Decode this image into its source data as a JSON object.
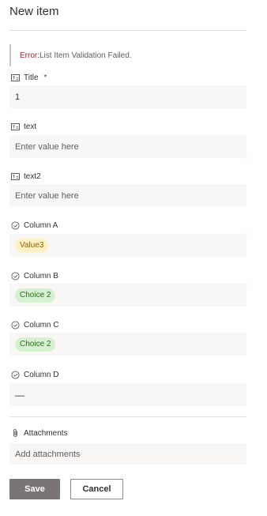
{
  "panel": {
    "title": "New item",
    "error_prefix": "Error:",
    "error_message": " List Item Validation Failed."
  },
  "fields": {
    "title": {
      "label": "Title",
      "required_mark": "*",
      "value": "1",
      "icon": "text-field-icon"
    },
    "text": {
      "label": "text",
      "placeholder": "Enter value here",
      "icon": "text-field-icon"
    },
    "text2": {
      "label": "text2",
      "placeholder": "Enter value here",
      "icon": "text-field-icon"
    },
    "column_a": {
      "label": "Column A",
      "value": "Value3",
      "icon": "choice-check-icon",
      "pill_color": "#fff1c6"
    },
    "column_b": {
      "label": "Column B",
      "value": "Choice 2",
      "icon": "choice-check-icon",
      "pill_color": "#d6f1d0"
    },
    "column_c": {
      "label": "Column C",
      "value": "Choice 2",
      "icon": "choice-check-icon",
      "pill_color": "#d6f1d0"
    },
    "column_d": {
      "label": "Column D",
      "value": "—",
      "icon": "choice-check-icon"
    },
    "attachments": {
      "label": "Attachments",
      "placeholder": "Add attachments",
      "icon": "paperclip-icon"
    }
  },
  "buttons": {
    "save": "Save",
    "cancel": "Cancel"
  },
  "colors": {
    "error": "#a4262c",
    "field_background": "#f8f7f6",
    "save_button": "#7a7574"
  }
}
